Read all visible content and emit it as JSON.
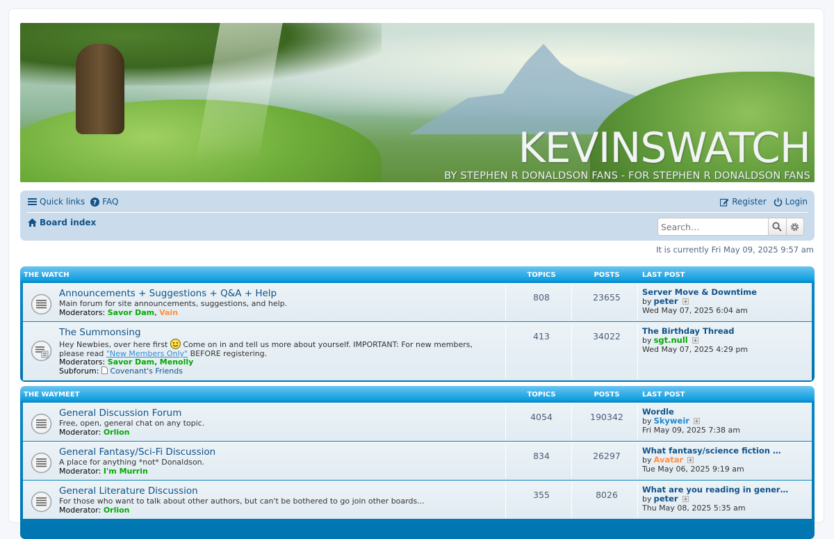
{
  "banner": {
    "brand": "KEVINSWATCH",
    "tagline": "BY STEPHEN R DONALDSON FANS - FOR STEPHEN R DONALDSON FANS"
  },
  "nav": {
    "quick_links": "Quick links",
    "faq": "FAQ",
    "register": "Register",
    "login": "Login",
    "board_index": "Board index",
    "search_placeholder": "Search…"
  },
  "current_time": "It is currently Fri May 09, 2025 9:57 am",
  "colors": {
    "header_blue": "#0076b1",
    "link": "#105289",
    "mod_green": "#00aa00",
    "mod_orange": "#ff9041"
  },
  "categories": [
    {
      "title": "THE WATCH",
      "col_topics": "TOPICS",
      "col_posts": "POSTS",
      "col_last": "LAST POST",
      "forums": [
        {
          "title": "Announcements + Suggestions + Q&A + Help",
          "desc": "Main forum for site announcements, suggestions, and help.",
          "mod_label": "Moderators:",
          "mods": [
            "Savor Dam",
            "Vain"
          ],
          "topics": "808",
          "posts": "23655",
          "last_title": "Server Move & Downtime",
          "last_by": "by",
          "last_user": "peter",
          "last_date": "Wed May 07, 2025 6:04 am"
        },
        {
          "title": "The Summonsing",
          "desc_a": "Hey Newbies, over here first",
          "desc_b": "Come on in and tell us more about yourself. IMPORTANT: For new members,",
          "desc_c": "please read",
          "desc_link": "\"New Members Only\"",
          "desc_d": "BEFORE registering.",
          "mod_label": "Moderators:",
          "mods": [
            "Savor Dam",
            "Menolly"
          ],
          "subforum_label": "Subforum:",
          "subforum": "Covenant's Friends",
          "topics": "413",
          "posts": "34022",
          "last_title": "The Birthday Thread",
          "last_by": "by",
          "last_user": "sgt.null",
          "last_date": "Wed May 07, 2025 4:29 pm"
        }
      ]
    },
    {
      "title": "THE WAYMEET",
      "col_topics": "TOPICS",
      "col_posts": "POSTS",
      "col_last": "LAST POST",
      "forums": [
        {
          "title": "General Discussion Forum",
          "desc": "Free, open, general chat on any topic.",
          "mod_label": "Moderator:",
          "mods": [
            "Orlion"
          ],
          "topics": "4054",
          "posts": "190342",
          "last_title": "Wordle",
          "last_by": "by",
          "last_user": "Skyweir",
          "last_date": "Fri May 09, 2025 7:38 am"
        },
        {
          "title": "General Fantasy/Sci-Fi Discussion",
          "desc": "A place for anything *not* Donaldson.",
          "mod_label": "Moderator:",
          "mods": [
            "I'm Murrin"
          ],
          "topics": "834",
          "posts": "26297",
          "last_title": "What fantasy/science fiction …",
          "last_by": "by",
          "last_user": "Avatar",
          "last_date": "Tue May 06, 2025 9:19 am"
        },
        {
          "title": "General Literature Discussion",
          "desc": "For those who want to talk about other authors, but can't be bothered to go join other boards...",
          "mod_label": "Moderator:",
          "mods": [
            "Orlion"
          ],
          "topics": "355",
          "posts": "8026",
          "last_title": "What are you reading in gener…",
          "last_by": "by",
          "last_user": "peter",
          "last_date": "Thu May 08, 2025 5:35 am"
        }
      ]
    }
  ]
}
